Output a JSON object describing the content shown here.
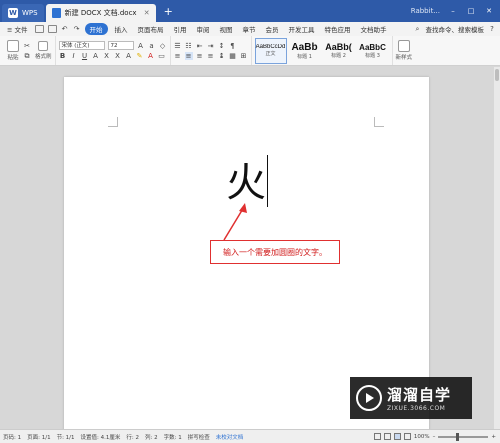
{
  "titlebar": {
    "app_tab": "WPS",
    "doc_tab": "新建 DOCX 文档.docx",
    "user": "Rabbit..."
  },
  "menubar": {
    "file_label": "≡ 文件",
    "items": [
      "开始",
      "插入",
      "页面布局",
      "引用",
      "审阅",
      "视图",
      "章节",
      "会员",
      "开发工具",
      "特色应用",
      "文档助手"
    ],
    "active_index": 0,
    "search_label": "查找命令、搜索模板"
  },
  "ribbon": {
    "paste_label": "粘贴",
    "format_painter_label": "格式刷",
    "font_name": "宋体 (正文)",
    "font_size": "72",
    "styles": [
      {
        "sample": "AaBbCcDd",
        "label": "正文"
      },
      {
        "sample": "AaBb",
        "label": "标题 1"
      },
      {
        "sample": "AaBb(",
        "label": "标题 2"
      },
      {
        "sample": "AaBbC",
        "label": "标题 3"
      }
    ],
    "new_style_label": "新样式"
  },
  "document": {
    "text": "火",
    "callout": "输入一个需要加圆圈的文字。"
  },
  "watermark": {
    "title": "溜溜自学",
    "subtitle": "ZIXUE.3066.COM"
  },
  "statusbar": {
    "page_no": "页码: 1",
    "pages": "页面: 1/1",
    "section": "节: 1/1",
    "position": "设置值: 4.1厘米",
    "row": "行: 2",
    "col": "列: 2",
    "words": "字数: 1",
    "spell": "拼写检查",
    "doc_check": "未校对文档",
    "zoom": "100%"
  },
  "colors": {
    "titlebar": "#2e5aa8",
    "accent": "#2e72d2",
    "callout_red": "#e03030"
  }
}
